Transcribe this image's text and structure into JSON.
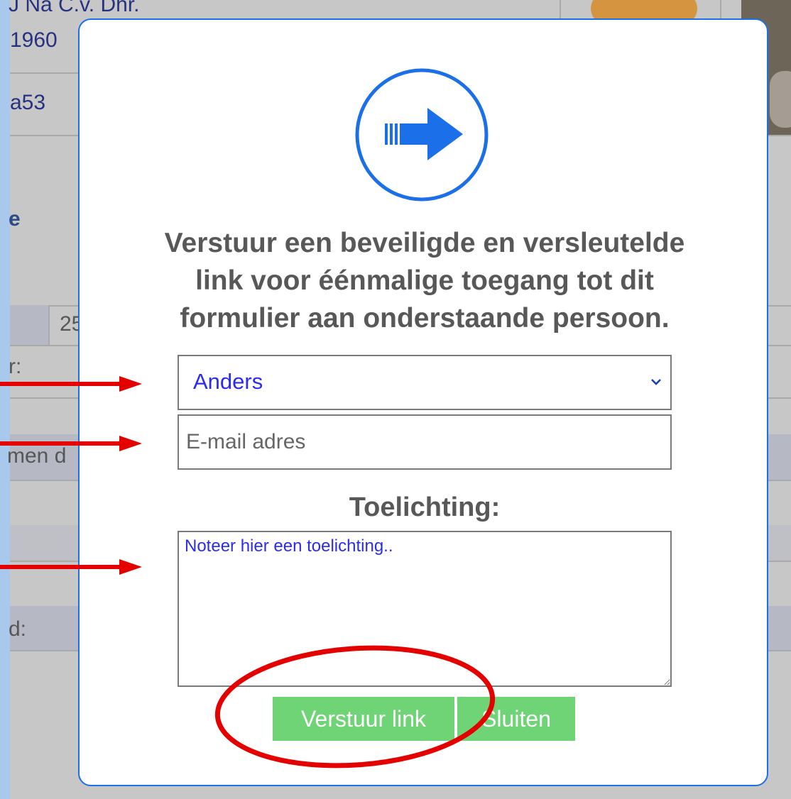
{
  "background": {
    "texts": [
      "J Na C.v. Dhr.",
      "1960",
      "a53",
      "e",
      "25",
      "r:",
      "men d",
      "d:"
    ]
  },
  "modal": {
    "icon": "arrow-right-circle-icon",
    "headline_lines": [
      "Verstuur een beveiligde en versleutelde",
      "link voor éénmalige toegang tot dit",
      "formulier aan onderstaande persoon."
    ],
    "recipient_select": {
      "selected": "Anders",
      "icon": "chevron-down-icon"
    },
    "email_field": {
      "placeholder": "E-mail adres",
      "value": ""
    },
    "note_label": "Toelichting:",
    "note_field": {
      "value": "Noteer hier een toelichting.."
    },
    "buttons": {
      "send": "Verstuur link",
      "close": "Sluiten"
    }
  },
  "annotations": {
    "arrow_color": "#e50000",
    "ellipse_color": "#e50000"
  },
  "colors": {
    "accent": "#1b6fe8",
    "button_green": "#6ed475",
    "text_blue": "#2c2cf0",
    "heading_gray": "#585858"
  }
}
